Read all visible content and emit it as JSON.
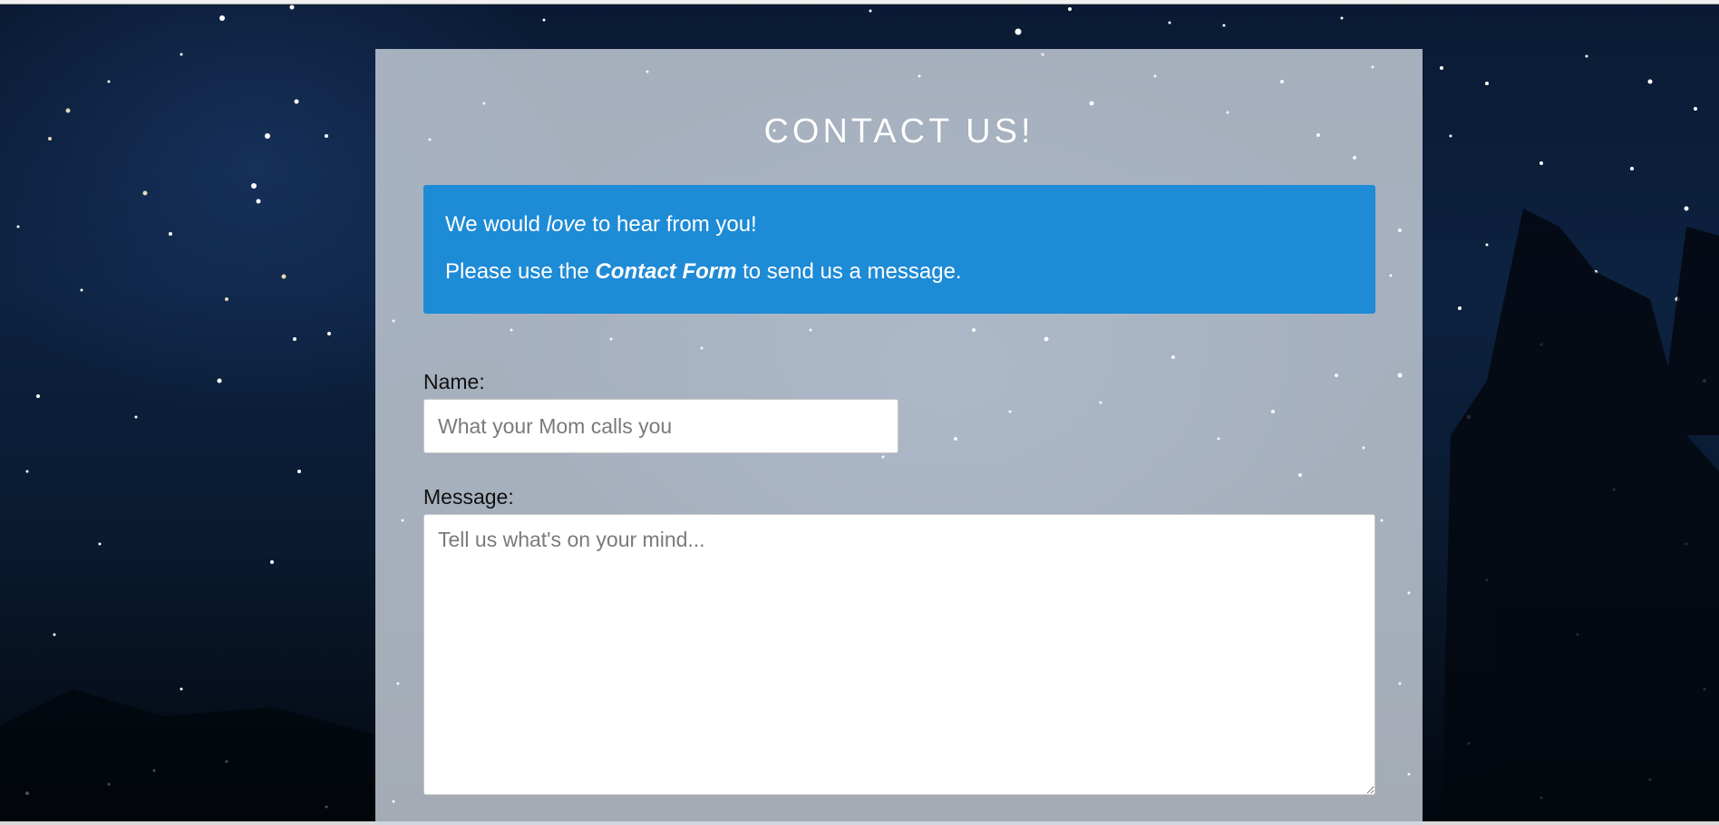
{
  "page": {
    "title": "CONTACT US!"
  },
  "callout": {
    "line1_pre": "We would ",
    "line1_em": "love",
    "line1_post": " to hear from you!",
    "line2_pre": "Please use the ",
    "line2_strong": "Contact Form",
    "line2_post": " to send us a message."
  },
  "form": {
    "name_label": "Name:",
    "name_placeholder": "What your Mom calls you",
    "name_value": "",
    "message_label": "Message:",
    "message_placeholder": "Tell us what's on your mind...",
    "message_value": ""
  },
  "colors": {
    "callout_bg": "#1e8bd6",
    "panel_bg": "rgba(205,212,222,0.80)",
    "title_text": "#ffffff"
  }
}
